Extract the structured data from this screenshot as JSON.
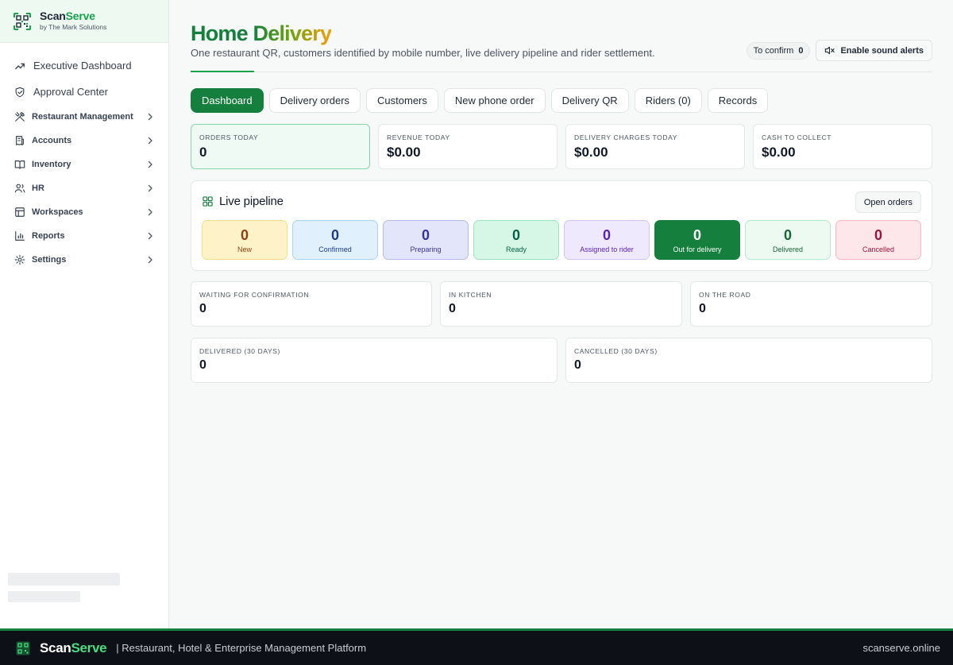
{
  "brand": {
    "name_a": "Scan",
    "name_b": "Serve",
    "sub": "by The Mark Solutions"
  },
  "sidebar": {
    "items": [
      {
        "label": "Executive Dashboard",
        "icon": "trend-icon",
        "size": "big",
        "chevron": false
      },
      {
        "label": "Approval Center",
        "icon": "check-shield-icon",
        "size": "big",
        "chevron": false
      },
      {
        "label": "Restaurant Management",
        "icon": "utensils-icon",
        "size": "small",
        "chevron": true
      },
      {
        "label": "Accounts",
        "icon": "receipt-icon",
        "size": "small",
        "chevron": true
      },
      {
        "label": "Inventory",
        "icon": "book-icon",
        "size": "small",
        "chevron": true
      },
      {
        "label": "HR",
        "icon": "users-icon",
        "size": "small",
        "chevron": true
      },
      {
        "label": "Workspaces",
        "icon": "grid-icon",
        "size": "small",
        "chevron": true
      },
      {
        "label": "Reports",
        "icon": "bar-chart-icon",
        "size": "small",
        "chevron": true
      },
      {
        "label": "Settings",
        "icon": "gear-icon",
        "size": "small",
        "chevron": true
      }
    ]
  },
  "header": {
    "title_a": "Home",
    "title_b": "Delivery",
    "subtitle": "One restaurant QR, customers identified by mobile number, live delivery pipeline and rider settlement.",
    "to_confirm_label": "To confirm",
    "to_confirm_count": "0",
    "sound_button": "Enable sound alerts"
  },
  "tabs": [
    {
      "label": "Dashboard",
      "active": true
    },
    {
      "label": "Delivery orders",
      "active": false
    },
    {
      "label": "Customers",
      "active": false
    },
    {
      "label": "New phone order",
      "active": false
    },
    {
      "label": "Delivery QR",
      "active": false
    },
    {
      "label": "Riders (0)",
      "active": false
    },
    {
      "label": "Records",
      "active": false
    }
  ],
  "stats": {
    "orders_today": {
      "label": "ORDERS TODAY",
      "value": "0"
    },
    "revenue_today": {
      "label": "REVENUE TODAY",
      "value": "$0.00"
    },
    "delivery_charges": {
      "label": "DELIVERY CHARGES TODAY",
      "value": "$0.00"
    },
    "cash_to_collect": {
      "label": "CASH TO COLLECT",
      "value": "$0.00"
    }
  },
  "pipeline": {
    "title": "Live pipeline",
    "open_button": "Open orders",
    "stages": [
      {
        "count": "0",
        "label": "New",
        "bg": "#fdf2c8",
        "border": "#f5dd8a",
        "color": "#92400e"
      },
      {
        "count": "0",
        "label": "Confirmed",
        "bg": "#e0f0fd",
        "border": "#a9d3f5",
        "color": "#1e3a8a"
      },
      {
        "count": "0",
        "label": "Preparing",
        "bg": "#e3e6fb",
        "border": "#b4bcef",
        "color": "#3730a3"
      },
      {
        "count": "0",
        "label": "Ready",
        "bg": "#d6f7e6",
        "border": "#9ee3bf",
        "color": "#065f46"
      },
      {
        "count": "0",
        "label": "Assigned to rider",
        "bg": "#efe9fd",
        "border": "#d2c3f7",
        "color": "#5b21b6"
      },
      {
        "count": "0",
        "label": "Out for delivery",
        "bg": "#15803d",
        "border": "#15803d",
        "color": "#ffffff"
      },
      {
        "count": "0",
        "label": "Delivered",
        "bg": "#edfaf2",
        "border": "#b8e8cb",
        "color": "#166534"
      },
      {
        "count": "0",
        "label": "Cancelled",
        "bg": "#fde7ea",
        "border": "#f7b9c2",
        "color": "#9f1239"
      }
    ]
  },
  "status": {
    "waiting": {
      "label": "WAITING FOR CONFIRMATION",
      "value": "0"
    },
    "kitchen": {
      "label": "IN KITCHEN",
      "value": "0"
    },
    "road": {
      "label": "ON THE ROAD",
      "value": "0"
    },
    "delivered_30": {
      "label": "DELIVERED (30 DAYS)",
      "value": "0"
    },
    "cancelled_30": {
      "label": "CANCELLED (30 DAYS)",
      "value": "0"
    }
  },
  "footer": {
    "name_a": "Scan",
    "name_b": "Serve",
    "tagline": "| Restaurant, Hotel & Enterprise Management Platform",
    "domain": "scanserve.online"
  }
}
